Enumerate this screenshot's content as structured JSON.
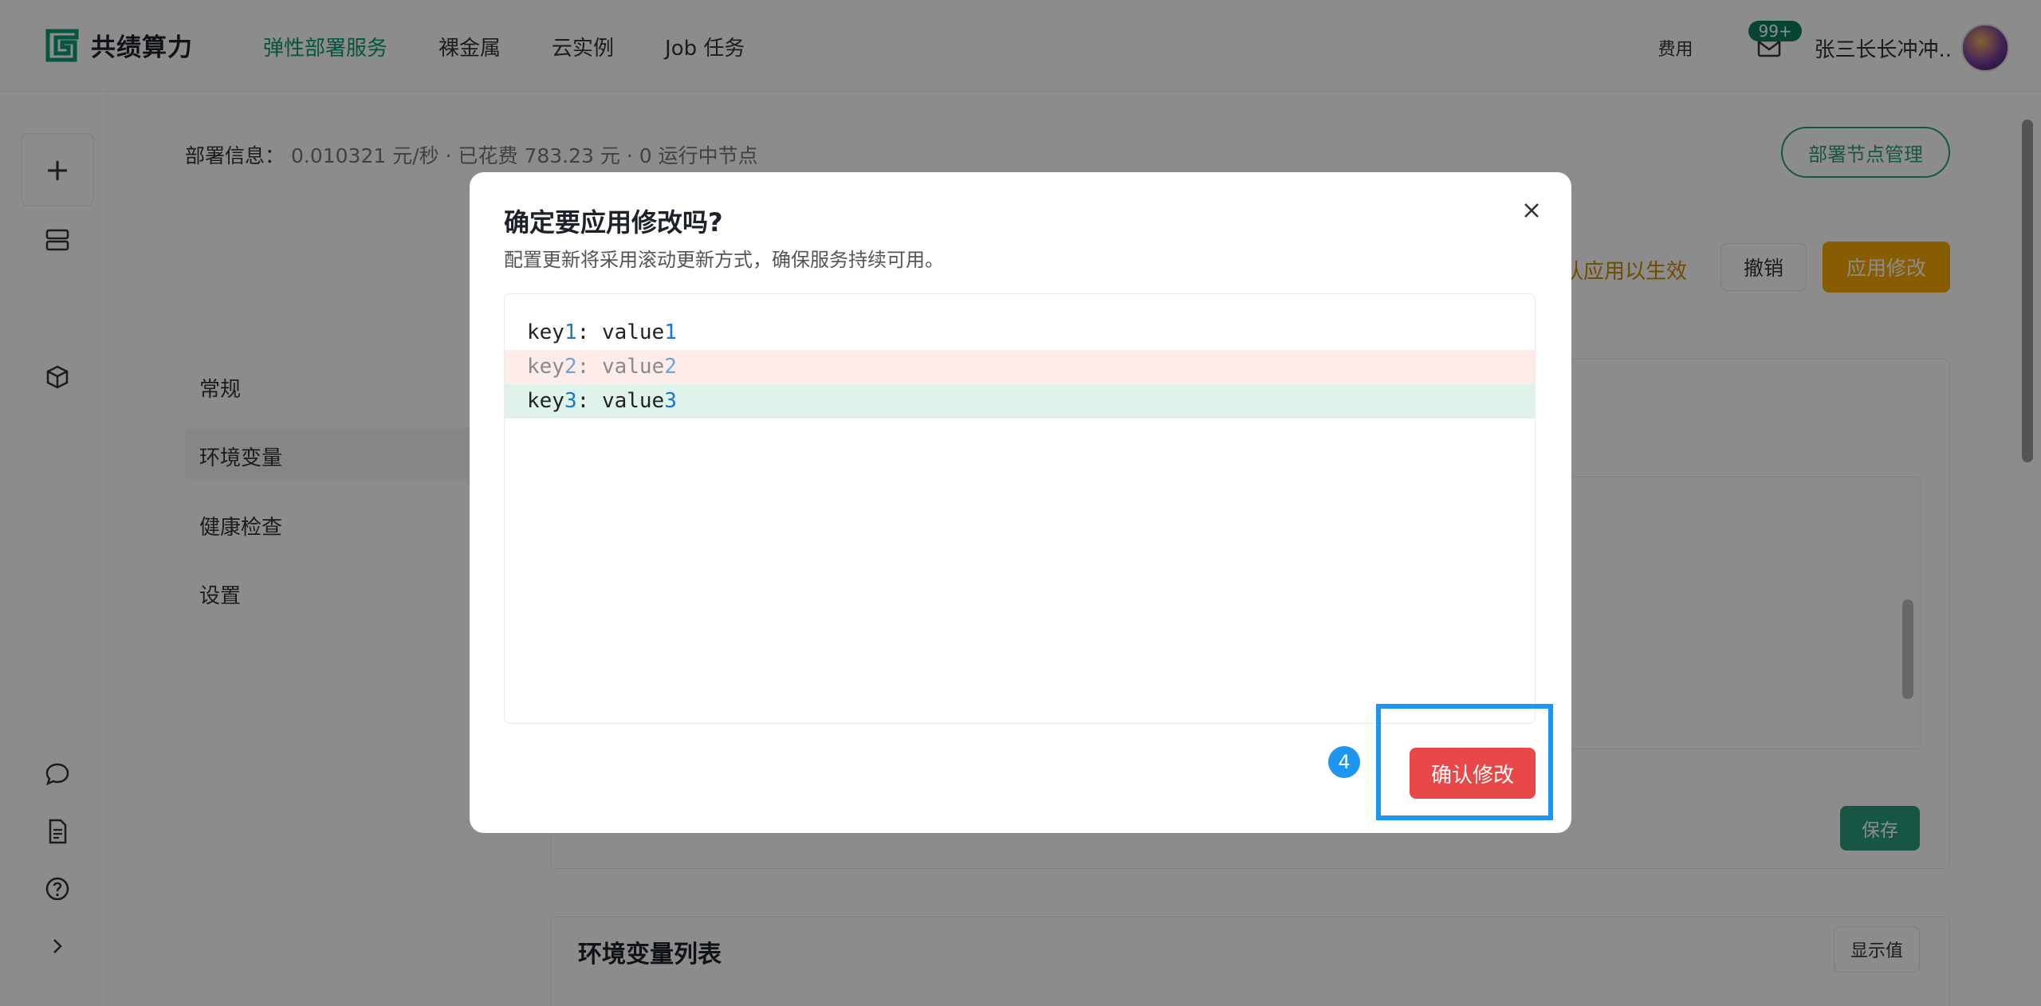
{
  "brand": {
    "name": "共绩算力",
    "accent": "#0b9b74"
  },
  "nav": {
    "items": [
      {
        "label": "弹性部署服务",
        "active": true
      },
      {
        "label": "裸金属",
        "active": false
      },
      {
        "label": "云实例",
        "active": false
      },
      {
        "label": "Job 任务",
        "active": false
      }
    ]
  },
  "topright": {
    "fee_label": "费用",
    "mail_badge": "99+",
    "username": "张三长长冲冲.."
  },
  "rail": {
    "add_label": "+"
  },
  "deploy_info": {
    "label": "部署信息：",
    "rate": "0.010321 元/秒",
    "spent": "已花费 783.23 元",
    "nodes": "0 运行中节点",
    "separator": "·",
    "manage_button": "部署节点管理"
  },
  "toolbar": {
    "hint": "认应用以生效",
    "cancel_label": "撤销",
    "apply_label": "应用修改"
  },
  "side_menu": [
    "常规",
    "环境变量",
    "健康检查",
    "设置"
  ],
  "env_panel": {
    "save_label": "保存"
  },
  "env_list": {
    "title": "环境变量列表",
    "show_values_label": "显示值"
  },
  "modal": {
    "title": "确定要应用修改吗?",
    "subtitle": "配置更新将采用滚动更新方式，确保服务持续可用。",
    "close_icon": "close-icon",
    "diff": [
      {
        "key": "key",
        "n": "1",
        "sep": ": ",
        "val": "value",
        "vn": "1",
        "state": "unchanged"
      },
      {
        "key": "key",
        "n": "2",
        "sep": ": ",
        "val": "value",
        "vn": "2",
        "state": "removed"
      },
      {
        "key": "key",
        "n": "3",
        "sep": ": ",
        "val": "value",
        "vn": "3",
        "state": "added"
      }
    ],
    "confirm_label": "确认修改",
    "confirm_color": "#e84848"
  },
  "annotation": {
    "step": "4",
    "color": "#1e96f0"
  }
}
